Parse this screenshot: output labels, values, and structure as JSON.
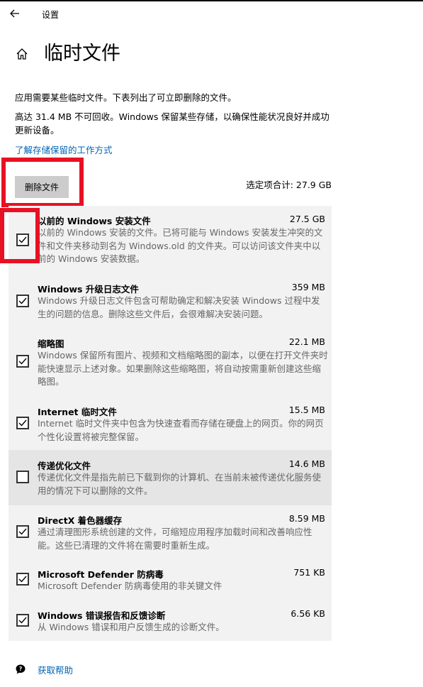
{
  "window": {
    "title": "设置"
  },
  "page": {
    "title": "临时文件",
    "description_1": "应用需要某些临时文件。下表列出了可立即删除的文件。",
    "description_2": "高达 31.4 MB 不可回收。Windows 保留某些存储，以确保性能状况良好并成功更新设备。",
    "link_label": "了解存储保留的工作方式",
    "delete_button_label": "删除文件",
    "selected_total": "选定项合计: 27.9 GB",
    "help_label": "获取帮助"
  },
  "items": [
    {
      "name": "以前的 Windows 安装文件",
      "size": "27.5 GB",
      "checked": true,
      "description": "以前的 Windows 安装的文件。已将可能与 Windows 安装发生冲突的文件和文件夹移动到名为 Windows.old 的文件夹。可以访问该文件夹中以前的 Windows 安装数据。"
    },
    {
      "name": "Windows 升级日志文件",
      "size": "359 MB",
      "checked": true,
      "description": "Windows 升级日志文件包含可帮助确定和解决安装 Windows 过程中发生的问题的信息。删除这些文件后，会很难解决安装问题。"
    },
    {
      "name": "缩略图",
      "size": "22.1 MB",
      "checked": true,
      "description": "Windows 保留所有图片、视频和文档缩略图的副本，以便在打开文件夹时能快速显示上述对象。如果删除这些缩略图，将自动按需重新创建这些缩略图。"
    },
    {
      "name": "Internet 临时文件",
      "size": "15.5 MB",
      "checked": true,
      "description": "Internet 临时文件夹中包含为快速查看而存储在硬盘上的网页。你的网页个性化设置将被完整保留。"
    },
    {
      "name": "传递优化文件",
      "size": "14.6 MB",
      "checked": false,
      "description": "传递优化文件是指先前已下载到你的计算机、在当前未被传递优化服务使用的情况下可以删除的文件。"
    },
    {
      "name": "DirectX 着色器缓存",
      "size": "8.59 MB",
      "checked": true,
      "description": "通过清理图形系统创建的文件，可缩短应用程序加载时间和改善响应性能。这些已清理的文件将在需要时重新生成。"
    },
    {
      "name": "Microsoft Defender 防病毒",
      "size": "751 KB",
      "checked": true,
      "description": "Microsoft Defender 防病毒使用的非关键文件"
    },
    {
      "name": "Windows 错误报告和反馈诊断",
      "size": "6.56 KB",
      "checked": true,
      "description": "从 Windows 错误和用户反馈生成的诊断文件。"
    }
  ],
  "icons": {
    "back": "arrow-left-icon",
    "home": "home-icon",
    "check": "checkmark-icon",
    "help": "help-chat-icon"
  },
  "colors": {
    "accent_link": "#0063b1",
    "highlight": "#e81123",
    "panel": "#f2f2f2",
    "button": "#cccccc"
  }
}
